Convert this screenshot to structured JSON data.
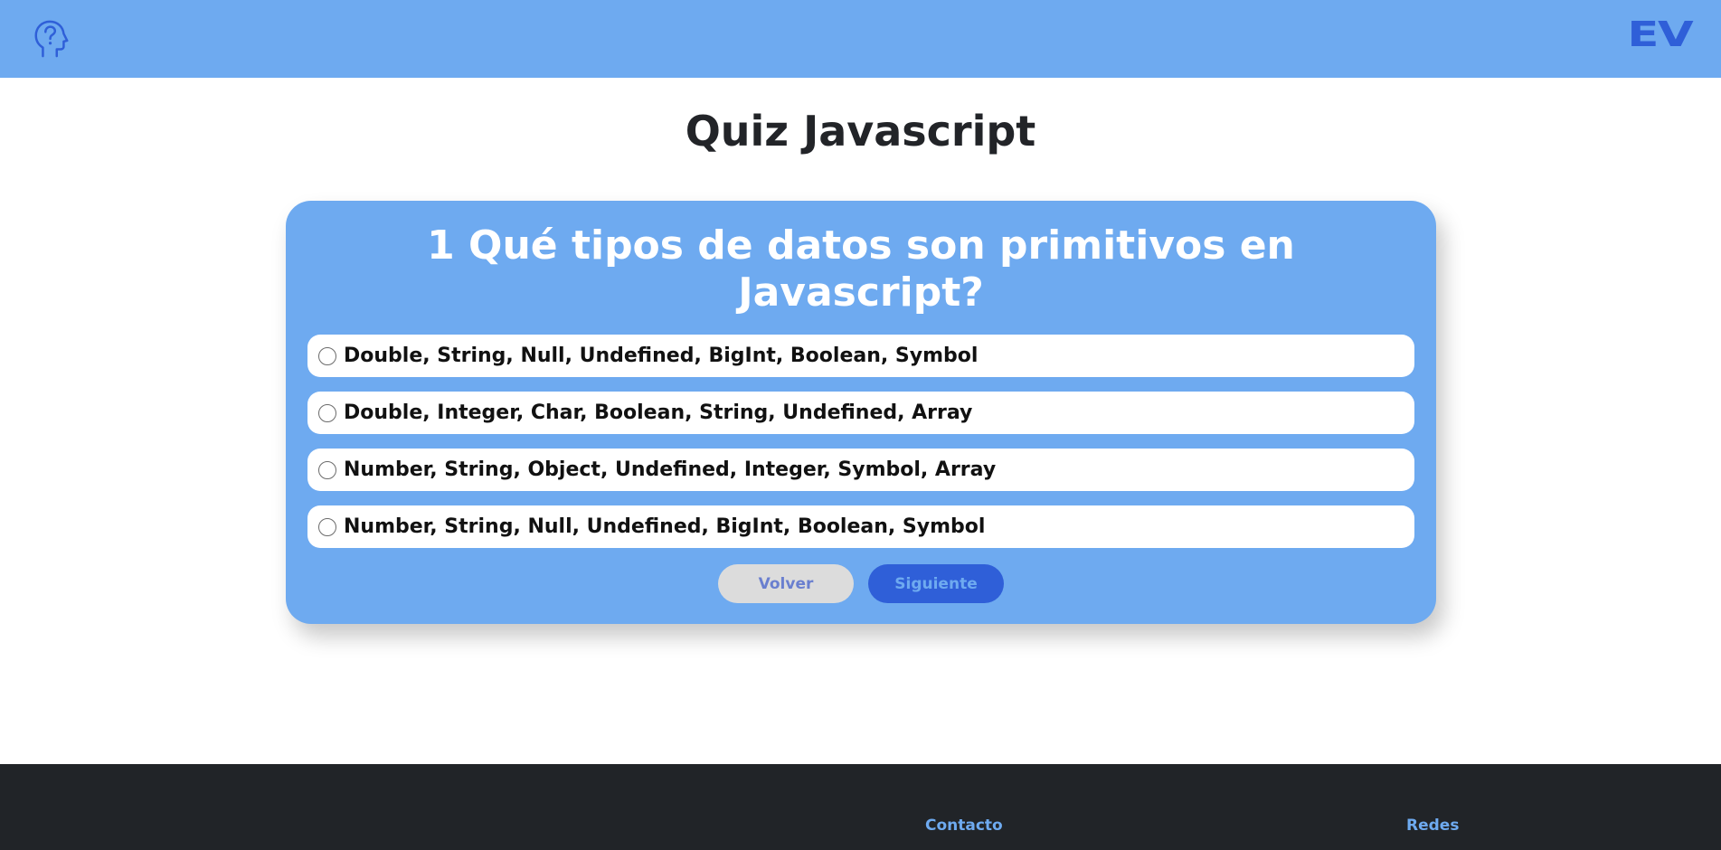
{
  "header": {
    "icon": "help-head-icon",
    "logo": "EV",
    "accent_color": "#2f5fd8",
    "background_color": "#6eaaf0"
  },
  "page": {
    "title": "Quiz Javascript"
  },
  "quiz": {
    "question": "1 Qué tipos de datos son primitivos en Javascript?",
    "options": [
      {
        "label": "Double, String, Null, Undefined, BigInt, Boolean, Symbol",
        "selected": false
      },
      {
        "label": "Double, Integer, Char, Boolean, String, Undefined, Array",
        "selected": false
      },
      {
        "label": "Number, String, Object, Undefined, Integer, Symbol, Array",
        "selected": false
      },
      {
        "label": "Number, String, Null, Undefined, BigInt, Boolean, Symbol",
        "selected": false
      }
    ],
    "back_label": "Volver",
    "next_label": "Siguiente"
  },
  "footer": {
    "contact_label": "Contacto",
    "social_label": "Redes",
    "background_color": "#212428"
  }
}
